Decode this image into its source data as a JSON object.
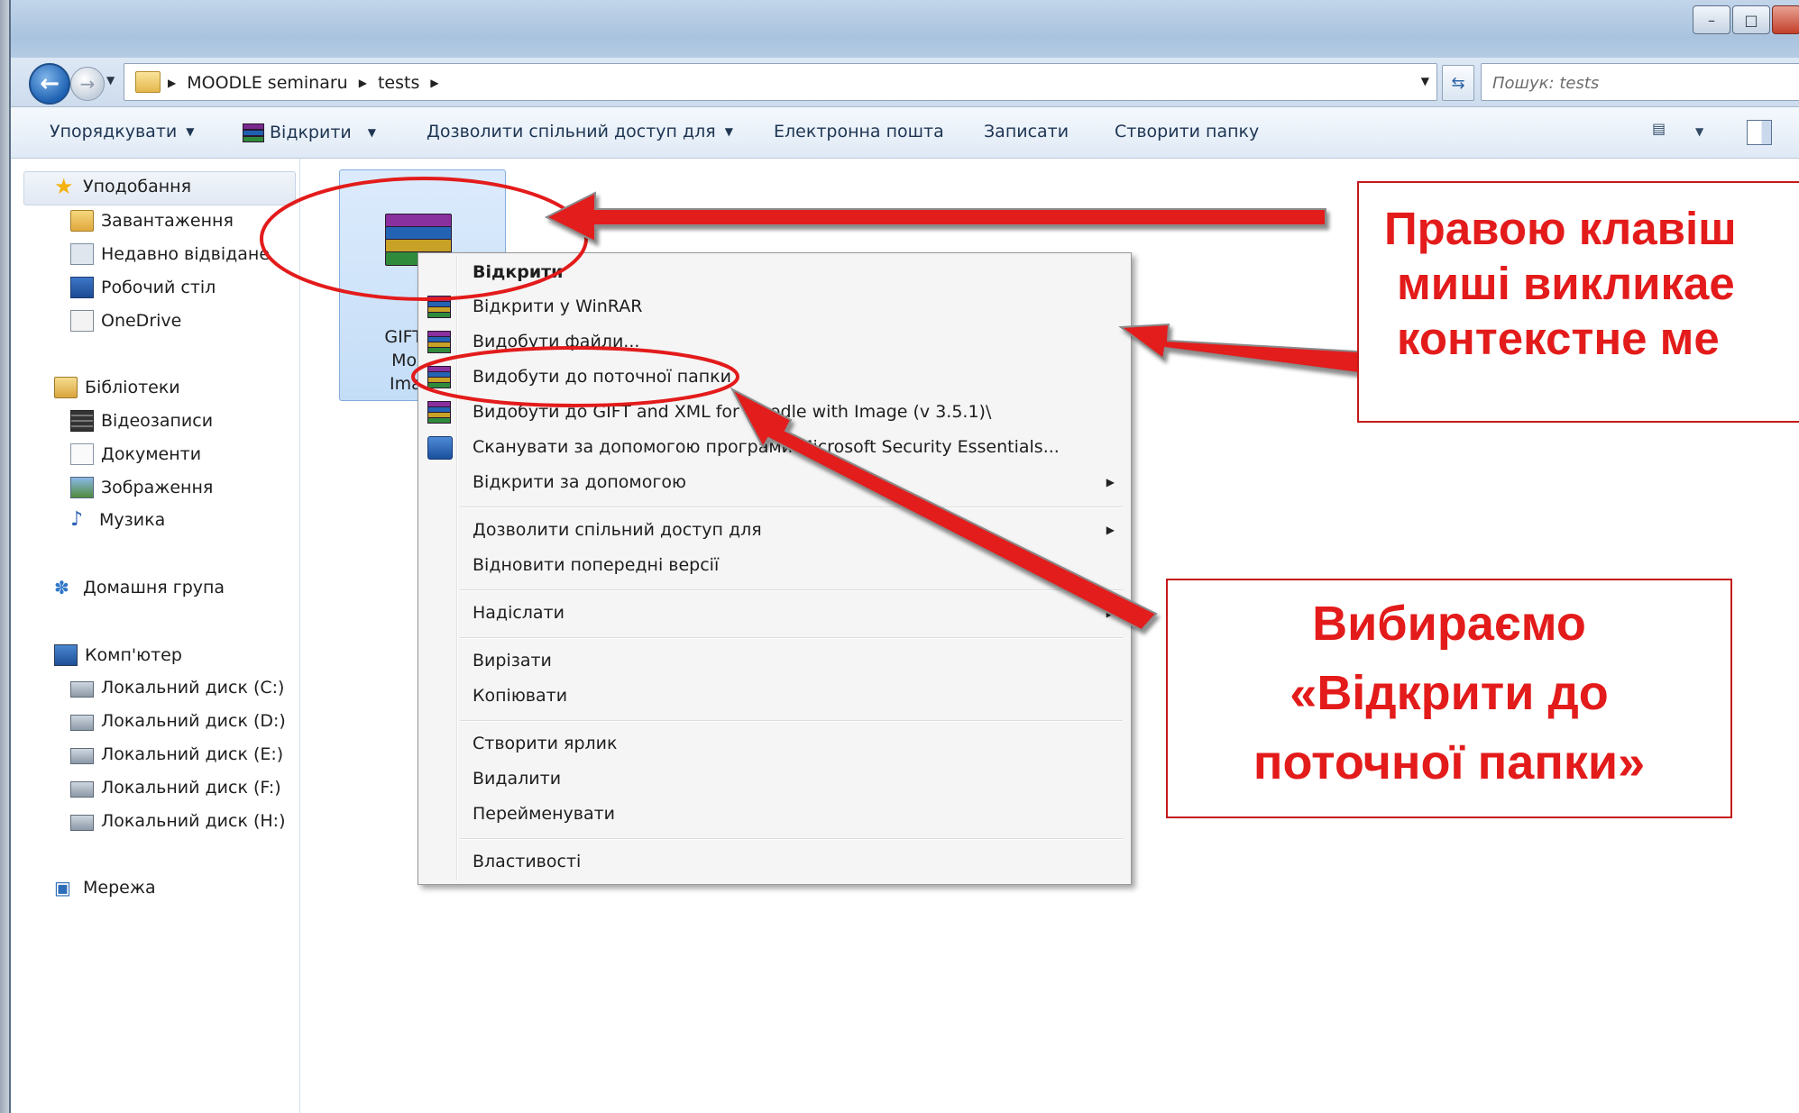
{
  "address_bar": {
    "breadcrumbs": [
      "MOODLE seminaru",
      "tests"
    ],
    "search_placeholder": "Пошук: tests"
  },
  "toolbar": {
    "organize": "Упорядкувати",
    "open": "Відкрити",
    "share_with": "Дозволити спільний доступ для",
    "email": "Електронна пошта",
    "burn": "Записати",
    "new_folder": "Створити папку"
  },
  "nav": {
    "favorites": "Уподобання",
    "downloads": "Завантаження",
    "recent": "Недавно відвідане",
    "desktop": "Робочий стіл",
    "onedrive": "OneDrive",
    "libraries": "Бібліотеки",
    "videos": "Відеозаписи",
    "documents": "Документи",
    "pictures": "Зображення",
    "music": "Музика",
    "homegroup": "Домашня група",
    "computer": "Комп'ютер",
    "drive_c": "Локальний диск (C:)",
    "drive_d": "Локальний диск (D:)",
    "drive_e": "Локальний диск (E:)",
    "drive_f": "Локальний диск (F:)",
    "drive_h": "Локальний диск (H:)",
    "network": "Мережа"
  },
  "file": {
    "label_lines": [
      "GIFT and",
      "Moodle",
      "Image ("
    ]
  },
  "context_menu": {
    "items": [
      "Відкрити",
      "Відкрити у WinRAR",
      "Видобути файли...",
      "Видобути до поточної папки",
      "Видобути до GIFT and XML for Moodle with Image (v 3.5.1)\\",
      "Сканувати за допомогою програми Microsoft Security Essentials...",
      "Відкрити за допомогою",
      "Дозволити спільний доступ для",
      "Відновити попередні версії",
      "Надіслати",
      "Вирізати",
      "Копіювати",
      "Створити ярлик",
      "Видалити",
      "Перейменувати",
      "Властивості"
    ]
  },
  "annotations": {
    "right_click": [
      "Правою клавіш",
      "миші викликае",
      "контекстне ме"
    ],
    "choose": [
      "Вибираємо",
      "«Відкрити до",
      "поточної папки»"
    ]
  },
  "colors": {
    "annotation_red": "#e31b1b",
    "selection_blue": "#c4ddf7"
  }
}
